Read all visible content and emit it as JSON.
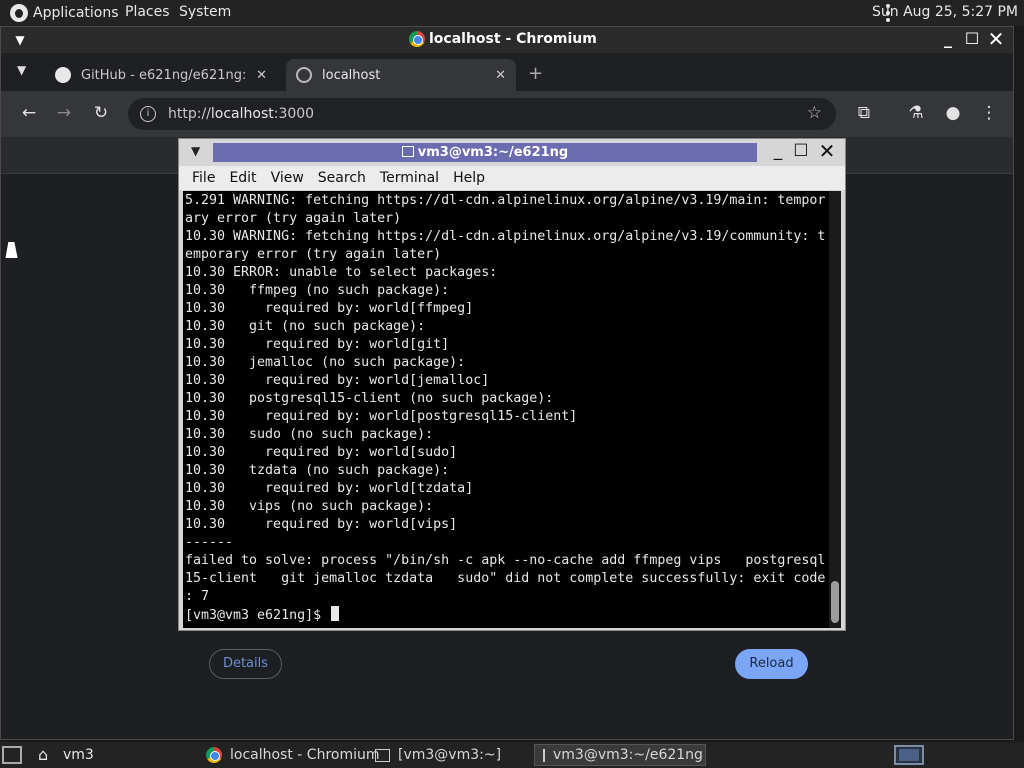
{
  "top_panel": {
    "applications": "Applications",
    "places": "Places",
    "system": "System",
    "clock": "Sun Aug 25,  5:27 PM"
  },
  "chromium": {
    "window_title": "localhost - Chromium",
    "tabs": [
      {
        "label": "GitHub - e621ng/e621ng: e6"
      },
      {
        "label": "localhost"
      }
    ],
    "url": {
      "scheme": "http://",
      "host": "localhost",
      "port": ":3000"
    },
    "page": {
      "details_label": "Details",
      "reload_label": "Reload"
    }
  },
  "terminal": {
    "title": "vm3@vm3:~/e621ng",
    "menu": [
      "File",
      "Edit",
      "View",
      "Search",
      "Terminal",
      "Help"
    ],
    "lines": [
      "5.291 WARNING: fetching https://dl-cdn.alpinelinux.org/alpine/v3.19/main: tempor",
      "ary error (try again later)",
      "10.30 WARNING: fetching https://dl-cdn.alpinelinux.org/alpine/v3.19/community: t",
      "emporary error (try again later)",
      "10.30 ERROR: unable to select packages:",
      "10.30   ffmpeg (no such package):",
      "10.30     required by: world[ffmpeg]",
      "10.30   git (no such package):",
      "10.30     required by: world[git]",
      "10.30   jemalloc (no such package):",
      "10.30     required by: world[jemalloc]",
      "10.30   postgresql15-client (no such package):",
      "10.30     required by: world[postgresql15-client]",
      "10.30   sudo (no such package):",
      "10.30     required by: world[sudo]",
      "10.30   tzdata (no such package):",
      "10.30     required by: world[tzdata]",
      "10.30   vips (no such package):",
      "10.30     required by: world[vips]",
      "------",
      "failed to solve: process \"/bin/sh -c apk --no-cache add ffmpeg vips   postgresql",
      "15-client   git jemalloc tzdata   sudo\" did not complete successfully: exit code",
      ": 7"
    ],
    "prompt": "[vm3@vm3 e621ng]$ "
  },
  "taskbar": {
    "workspace": "vm3",
    "tasks": [
      {
        "label": "localhost - Chromium"
      },
      {
        "label": "[vm3@vm3:~]"
      },
      {
        "label": "vm3@vm3:~/e621ng"
      }
    ]
  }
}
